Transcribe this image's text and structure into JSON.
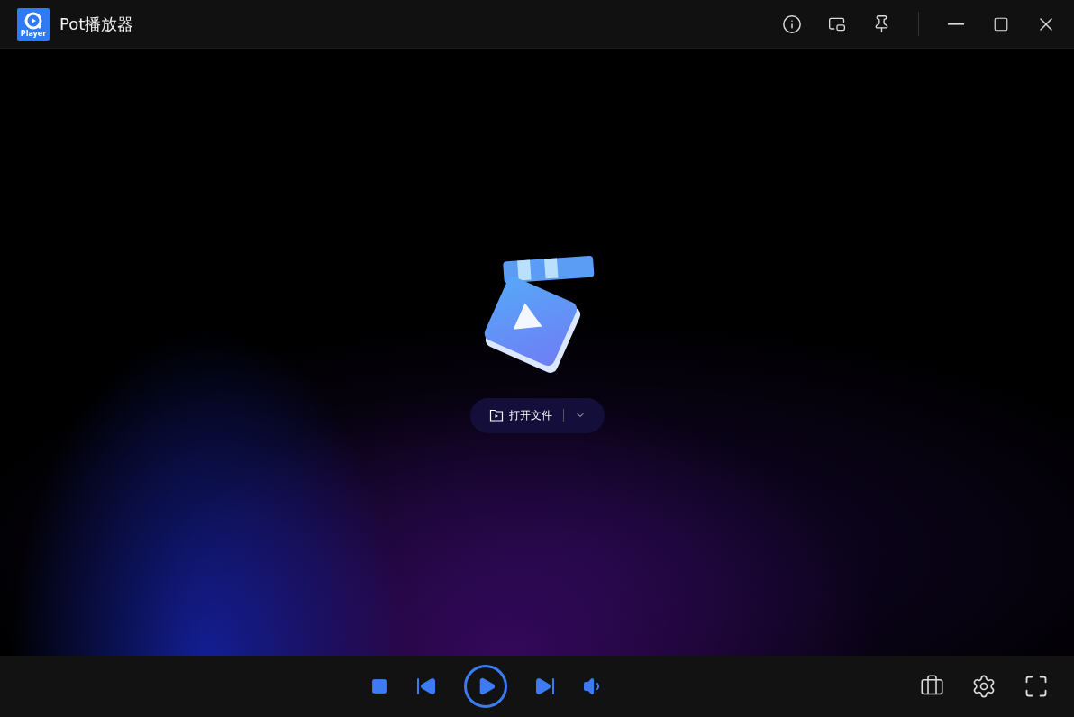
{
  "window": {
    "title": "Pot播放器",
    "logo_text": "Player"
  },
  "open_button": {
    "label": "打开文件"
  }
}
